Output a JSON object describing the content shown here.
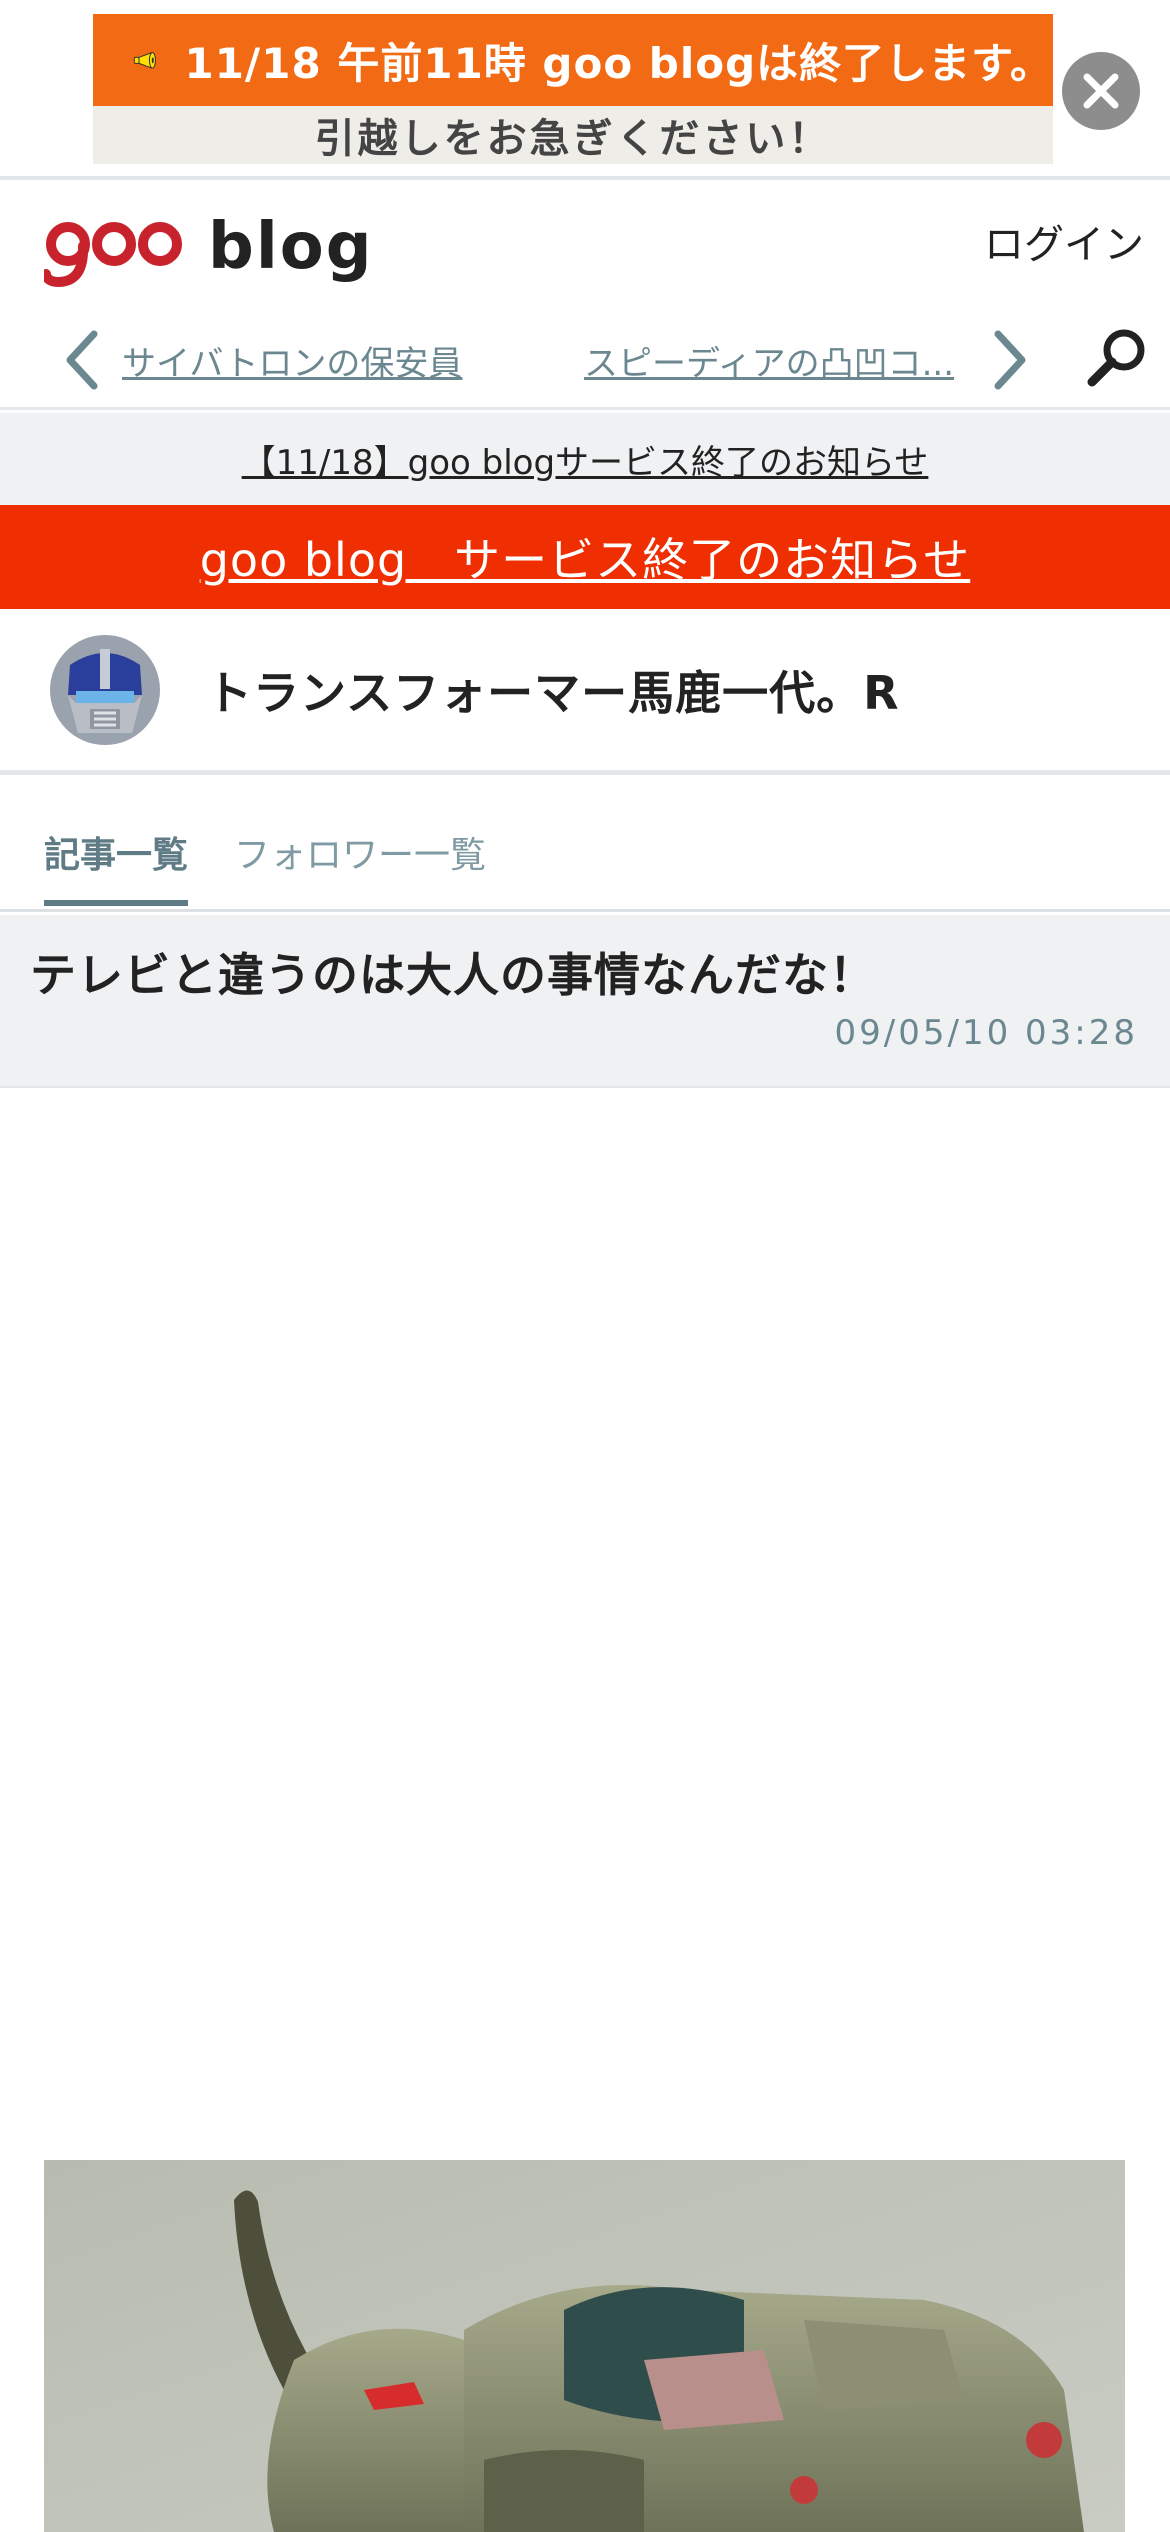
{
  "promo": {
    "line1": "11/18 午前11時 goo blogは終了します。",
    "line2": "引越しをお急ぎください！"
  },
  "header": {
    "logo_text": "blog",
    "login_label": "ログイン",
    "prev_link": "サイバトロンの保安員",
    "next_link": "スピーディアの凸凹コ..."
  },
  "notice": {
    "text": "【11/18】goo blogサービス終了のお知らせ"
  },
  "service_banner": {
    "text": "goo blog　サービス終了のお知らせ"
  },
  "blog": {
    "title": "トランスフォーマー馬鹿一代。R"
  },
  "tabs": [
    {
      "label": "記事一覧",
      "active": true
    },
    {
      "label": "フォロワー一覧",
      "active": false
    }
  ],
  "article": {
    "title": "テレビと違うのは大人の事情なんだな！",
    "date": "09/05/10 03:28"
  },
  "colors": {
    "promo_orange": "#f26a13",
    "service_red": "#ef2f02",
    "goo_red": "#c8222c",
    "link_teal": "#6b8790"
  },
  "icons": [
    "megaphone-icon",
    "close-icon",
    "chevron-left-icon",
    "chevron-right-icon",
    "search-icon"
  ]
}
